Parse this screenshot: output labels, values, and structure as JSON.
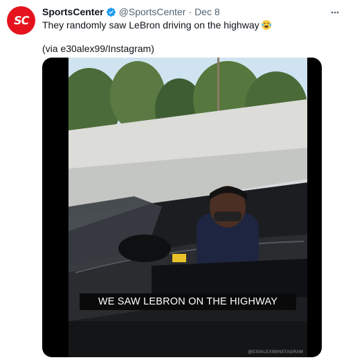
{
  "author": {
    "display_name": "SportsCenter",
    "handle": "@SportsCenter",
    "separator": "·",
    "date": "Dec 8",
    "avatar_text": "SC",
    "brand_color": "#e5131d",
    "verified_color": "#1d9bf0"
  },
  "tweet": {
    "text_line1": "They randomly saw LeBron driving on the highway",
    "text_line2": "(via e30alex99/Instagram)",
    "emoji": "face-with-tears-of-joy"
  },
  "media": {
    "caption": "WE SAW LEBRON ON THE HIGHWAY",
    "watermark": "@E30ALEX99INSTAGRAM"
  },
  "icons": {
    "more": "more-options-icon",
    "verified": "verified-badge-icon"
  }
}
